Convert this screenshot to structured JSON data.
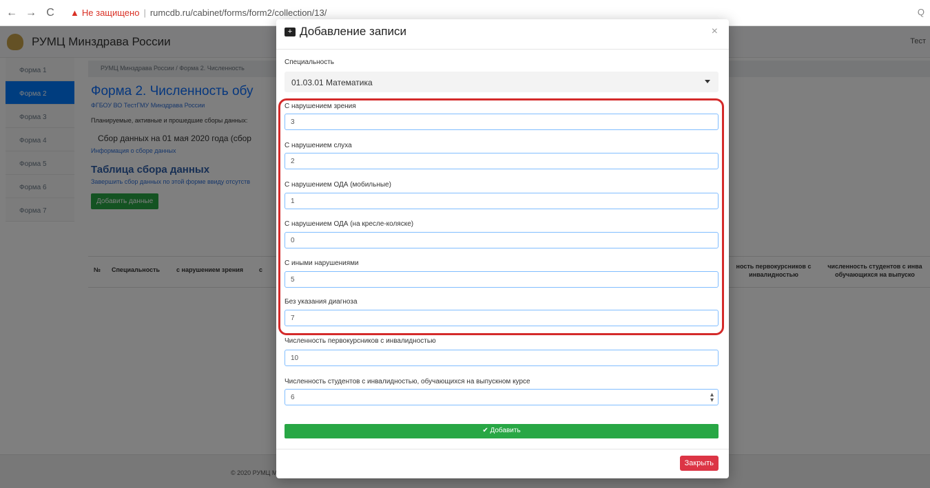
{
  "browser": {
    "back": "←",
    "forward": "→",
    "reload": "C",
    "warning": "▲",
    "not_secure": "Не защищено",
    "separator": "|",
    "url": "rumcdb.ru/cabinet/forms/form2/collection/13/",
    "zoom": "Q"
  },
  "navbar": {
    "brand": "РУМЦ Минздрава России",
    "user": "Тест"
  },
  "sidebar": {
    "items": [
      {
        "label": "Форма 1"
      },
      {
        "label": "Форма 2"
      },
      {
        "label": "Форма 3"
      },
      {
        "label": "Форма 4"
      },
      {
        "label": "Форма 5"
      },
      {
        "label": "Форма 6"
      },
      {
        "label": "Форма 7"
      }
    ]
  },
  "main": {
    "breadcrumb": "РУМЦ Минздрава России / Форма 2. Численность",
    "title": "Форма 2. Численность обу",
    "org": "ФГБОУ ВО ТестГМУ Минздрава России",
    "planned": "Планируемые, активные и прошедшие сборы данных:",
    "collection": "Сбор данных на 01 мая 2020 года (сбор",
    "info_link": "Информация о сборе данных",
    "table_title": "Таблица сбора данных",
    "table_sub": "Завершить сбор данных по этой форме ввиду отсутств",
    "add_data_btn": "Добавить данные",
    "table_headers": {
      "num": "№",
      "specialty": "Специальность",
      "vision": "с нарушением зрения",
      "c": "с",
      "freshmen": "ность первокурсников с инвалидностью",
      "graduates": "численность студентов с инва обучающихся на выпуско"
    }
  },
  "footer": {
    "text": "© 2020 РУМЦ Минздрава России | Инструкция | Документы | Помощь"
  },
  "modal": {
    "title": "Добавление записи",
    "close_x": "×",
    "specialty_label": "Специальность",
    "specialty_value": "01.03.01 Математика",
    "fields": [
      {
        "label": "С нарушением зрения",
        "value": "3"
      },
      {
        "label": "С нарушением слуха",
        "value": "2"
      },
      {
        "label": "С нарушением ОДА (мобильные)",
        "value": "1"
      },
      {
        "label": "С нарушением ОДА (на кресле-коляске)",
        "value": "0"
      },
      {
        "label": "С иными нарушениями",
        "value": "5"
      },
      {
        "label": "Без указания диагноза",
        "value": "7"
      },
      {
        "label": "Численность первокурсников с инвалидностью",
        "value": "10"
      },
      {
        "label": "Численность студентов с инвалидностью, обучающихся на выпускном курсе",
        "value": "6"
      }
    ],
    "add_button": "Добавить",
    "close_button": "Закрыть"
  }
}
